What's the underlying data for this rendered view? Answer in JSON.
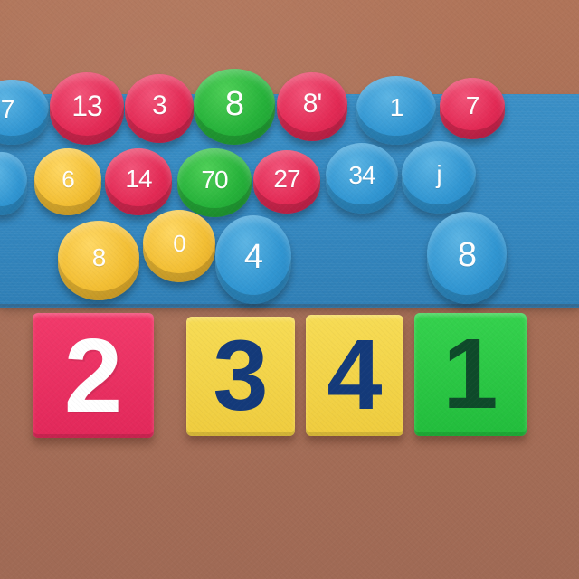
{
  "scene": {
    "pucks": [
      {
        "label": "7",
        "color": "blue"
      },
      {
        "label": "13",
        "color": "red"
      },
      {
        "label": "3",
        "color": "red"
      },
      {
        "label": "8",
        "color": "green"
      },
      {
        "label": "8'",
        "color": "red"
      },
      {
        "label": "1",
        "color": "blue"
      },
      {
        "label": "7",
        "color": "red"
      },
      {
        "label": "",
        "color": "blue"
      },
      {
        "label": "6",
        "color": "yellow"
      },
      {
        "label": "14",
        "color": "red"
      },
      {
        "label": "70",
        "color": "green"
      },
      {
        "label": "27",
        "color": "red"
      },
      {
        "label": "34",
        "color": "blue"
      },
      {
        "label": "j",
        "color": "blue"
      },
      {
        "label": "8",
        "color": "yellow"
      },
      {
        "label": "0",
        "color": "yellow"
      },
      {
        "label": "4",
        "color": "blue"
      },
      {
        "label": "8",
        "color": "blue"
      }
    ],
    "tiles": [
      {
        "label": "2",
        "color": "red",
        "text_color": "#ffffff"
      },
      {
        "label": "3",
        "color": "yellow",
        "text_color": "#143a7a"
      },
      {
        "label": "4",
        "color": "yellow",
        "text_color": "#143a7a"
      },
      {
        "label": "1",
        "color": "green",
        "text_color": "#0e4a2a"
      }
    ],
    "colors": {
      "red": "#e32a55",
      "blue": "#3196d2",
      "green": "#26b23a",
      "yellow": "#f3bf34",
      "mat": "#3487bf",
      "table": "#a86f57"
    }
  }
}
